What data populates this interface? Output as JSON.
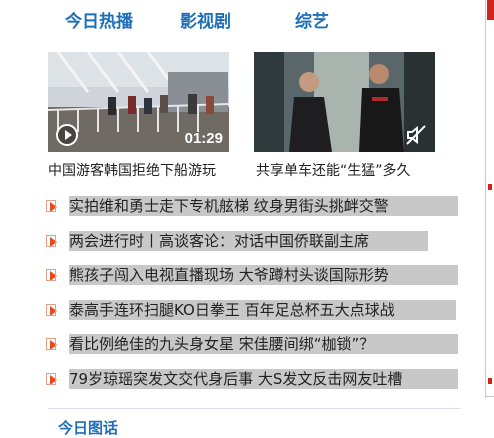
{
  "tabs": [
    {
      "label": "今日热播",
      "active": true
    },
    {
      "label": "影视剧"
    },
    {
      "label": "综艺"
    }
  ],
  "videos": [
    {
      "caption": "中国游客韩国拒绝下船游玩",
      "duration": "01:29",
      "icon": "play-icon"
    },
    {
      "caption": "共享单车还能“生猛”多久",
      "icon": "mute-icon"
    }
  ],
  "news": [
    "实拍维和勇士走下专机舷梯 纹身男街头挑衅交警",
    "两会进行时丨高谈客论：对话中国侨联副主席",
    "熊孩子闯入电视直播现场 大爷蹲村头谈国际形势",
    "泰高手连环扫腿KO日拳王 百年足总杯五大点球战",
    "看比例绝佳的九头身女星 宋佳腰间绑“枷锁”？",
    "79岁琼瑶突发文交代身后事 大S发文反击网友吐槽"
  ],
  "section_title": "今日图话",
  "colors": {
    "accent": "#1f6fb8",
    "bullet": "#e84a1c",
    "highlight": "#c8c8c8"
  }
}
